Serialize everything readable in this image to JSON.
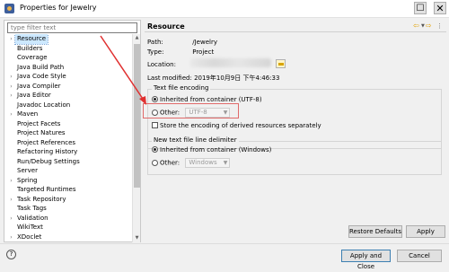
{
  "window": {
    "title": "Properties for Jewelry"
  },
  "left": {
    "filter_placeholder": "type filter text",
    "tree": [
      {
        "label": "Resource",
        "expandable": true,
        "selected": true
      },
      {
        "label": "Builders",
        "expandable": false
      },
      {
        "label": "Coverage",
        "expandable": false
      },
      {
        "label": "Java Build Path",
        "expandable": false
      },
      {
        "label": "Java Code Style",
        "expandable": true
      },
      {
        "label": "Java Compiler",
        "expandable": true
      },
      {
        "label": "Java Editor",
        "expandable": true
      },
      {
        "label": "Javadoc Location",
        "expandable": false
      },
      {
        "label": "Maven",
        "expandable": true
      },
      {
        "label": "Project Facets",
        "expandable": false
      },
      {
        "label": "Project Natures",
        "expandable": false
      },
      {
        "label": "Project References",
        "expandable": false
      },
      {
        "label": "Refactoring History",
        "expandable": false
      },
      {
        "label": "Run/Debug Settings",
        "expandable": false
      },
      {
        "label": "Server",
        "expandable": false
      },
      {
        "label": "Spring",
        "expandable": true
      },
      {
        "label": "Targeted Runtimes",
        "expandable": false
      },
      {
        "label": "Task Repository",
        "expandable": true
      },
      {
        "label": "Task Tags",
        "expandable": false
      },
      {
        "label": "Validation",
        "expandable": true
      },
      {
        "label": "WikiText",
        "expandable": false
      },
      {
        "label": "XDoclet",
        "expandable": true
      }
    ]
  },
  "right": {
    "title": "Resource",
    "path_label": "Path:",
    "path_value": "/Jewelry",
    "type_label": "Type:",
    "type_value": "Project",
    "location_label": "Location:",
    "last_modified_label": "Last modified:",
    "last_modified_value": "2019年10月9日 下午4:46:33",
    "encoding_group": {
      "title": "Text file encoding",
      "inherited": "Inherited from container (UTF-8)",
      "other": "Other:",
      "other_value": "UTF-8",
      "store_derived": "Store the encoding of derived resources separately"
    },
    "delimiter_group": {
      "title": "New text file line delimiter",
      "inherited": "Inherited from container (Windows)",
      "other": "Other:",
      "other_value": "Windows"
    },
    "restore_defaults": "Restore Defaults",
    "apply": "Apply"
  },
  "footer": {
    "apply_and_close": "Apply and Close",
    "cancel": "Cancel"
  },
  "colors": {
    "selection": "#cce8ff",
    "highlight": "#e06a6a",
    "arrow": "#e03030"
  }
}
